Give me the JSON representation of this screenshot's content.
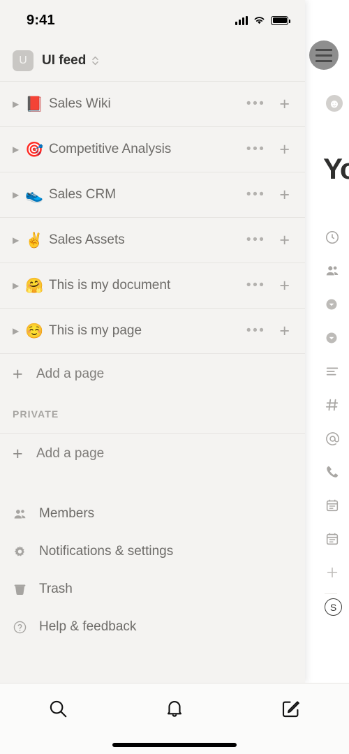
{
  "status_bar": {
    "time": "9:41",
    "signal_icon": "cellular-bars-icon",
    "wifi_icon": "wifi-icon",
    "battery_icon": "battery-full-icon"
  },
  "workspace": {
    "badge_letter": "U",
    "name": "UI feed",
    "switch_icon": "chevron-updown-icon"
  },
  "pages": [
    {
      "emoji": "📕",
      "emoji_name": "closed-book-emoji",
      "label": "Sales Wiki",
      "expand_icon": "triangle-right-icon",
      "more_icon": "ellipsis-icon",
      "add_icon": "plus-icon"
    },
    {
      "emoji": "🎯",
      "emoji_name": "dart-emoji",
      "label": "Competitive Analysis",
      "expand_icon": "triangle-right-icon",
      "more_icon": "ellipsis-icon",
      "add_icon": "plus-icon"
    },
    {
      "emoji": "👟",
      "emoji_name": "running-shoe-emoji",
      "label": "Sales CRM",
      "expand_icon": "triangle-right-icon",
      "more_icon": "ellipsis-icon",
      "add_icon": "plus-icon"
    },
    {
      "emoji": "✌️",
      "emoji_name": "victory-hand-emoji",
      "label": "Sales Assets",
      "expand_icon": "triangle-right-icon",
      "more_icon": "ellipsis-icon",
      "add_icon": "plus-icon"
    },
    {
      "emoji": "🤗",
      "emoji_name": "hugging-face-emoji",
      "label": "This is my document",
      "expand_icon": "triangle-right-icon",
      "more_icon": "ellipsis-icon",
      "add_icon": "plus-icon"
    },
    {
      "emoji": "☺️",
      "emoji_name": "smiling-face-emoji",
      "label": "This is my page",
      "expand_icon": "triangle-right-icon",
      "more_icon": "ellipsis-icon",
      "add_icon": "plus-icon"
    }
  ],
  "add_page_workspace": {
    "label": "Add a page",
    "icon": "plus-icon"
  },
  "private_section": {
    "header": "PRIVATE",
    "add_label": "Add a page",
    "add_icon": "plus-icon"
  },
  "menu": [
    {
      "label": "Members",
      "icon": "people-icon"
    },
    {
      "label": "Notifications & settings",
      "icon": "gear-icon"
    },
    {
      "label": "Trash",
      "icon": "trash-icon"
    },
    {
      "label": "Help & feedback",
      "icon": "question-circle-icon"
    }
  ],
  "tabbar": [
    {
      "name": "search",
      "icon": "search-icon"
    },
    {
      "name": "notifications",
      "icon": "bell-icon"
    },
    {
      "name": "compose",
      "icon": "compose-icon"
    }
  ],
  "document_panel": {
    "avatar_icon": "hamburger-avatar-icon",
    "emoji_button_icon": "smiley-face-icon",
    "title": "Yo",
    "block_icons": [
      "clock-icon",
      "people-icon",
      "chevron-down-filled-icon",
      "chevron-down-filled-icon",
      "text-lines-icon",
      "hash-icon",
      "at-icon",
      "phone-icon",
      "calendar-icon",
      "calendar-icon",
      "plus-icon"
    ],
    "badge_letter": "S"
  },
  "colors": {
    "sidebar_bg": "#f4f3f1",
    "divider": "#e6e4e1",
    "text": "#6e6c69",
    "muted": "#a6a4a1"
  }
}
